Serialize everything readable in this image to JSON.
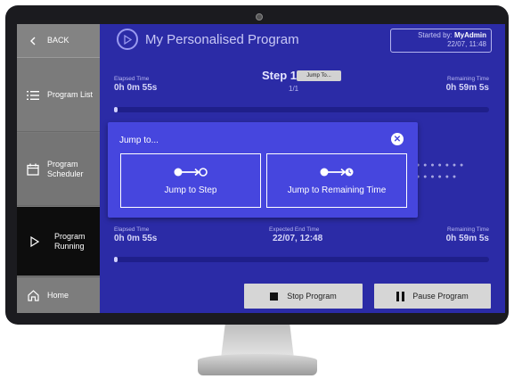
{
  "sidebar": {
    "back": "BACK",
    "program_list": "Program List",
    "program_scheduler": [
      "Program",
      "Scheduler"
    ],
    "program_running": [
      "Program",
      "Running"
    ],
    "home": "Home"
  },
  "header": {
    "title": "My Personalised Program",
    "started_label": "Started by: ",
    "started_user": "MyAdmin",
    "started_time": "22/07, 11:48"
  },
  "step_panel": {
    "elapsed_label": "Elapsed Time",
    "elapsed_value": "0h 0m 55s",
    "step_title": "Step 1",
    "jump_button": "Jump To...",
    "step_count": "1/1",
    "remaining_label": "Remaining Time",
    "remaining_value": "0h 59m 5s",
    "progress_fraction": 0.01
  },
  "program_panel": {
    "elapsed_label": "Elapsed Time",
    "elapsed_value": "0h 0m 55s",
    "end_label": "Expected End Time",
    "end_value": "22/07, 12:48",
    "remaining_label": "Remaining Time",
    "remaining_value": "0h 59m 5s",
    "progress_fraction": 0.01
  },
  "buttons": {
    "stop": "Stop Program",
    "pause": "Pause Program"
  },
  "modal": {
    "title": "Jump to...",
    "option_step": "Jump to Step",
    "option_time": "Jump to Remaining Time"
  },
  "colors": {
    "screen_bg": "#2b2ba6",
    "modal_bg": "#4646de",
    "sidebar_bg": "#7a7a7a",
    "active_sidebar": "#0d0d0d"
  }
}
